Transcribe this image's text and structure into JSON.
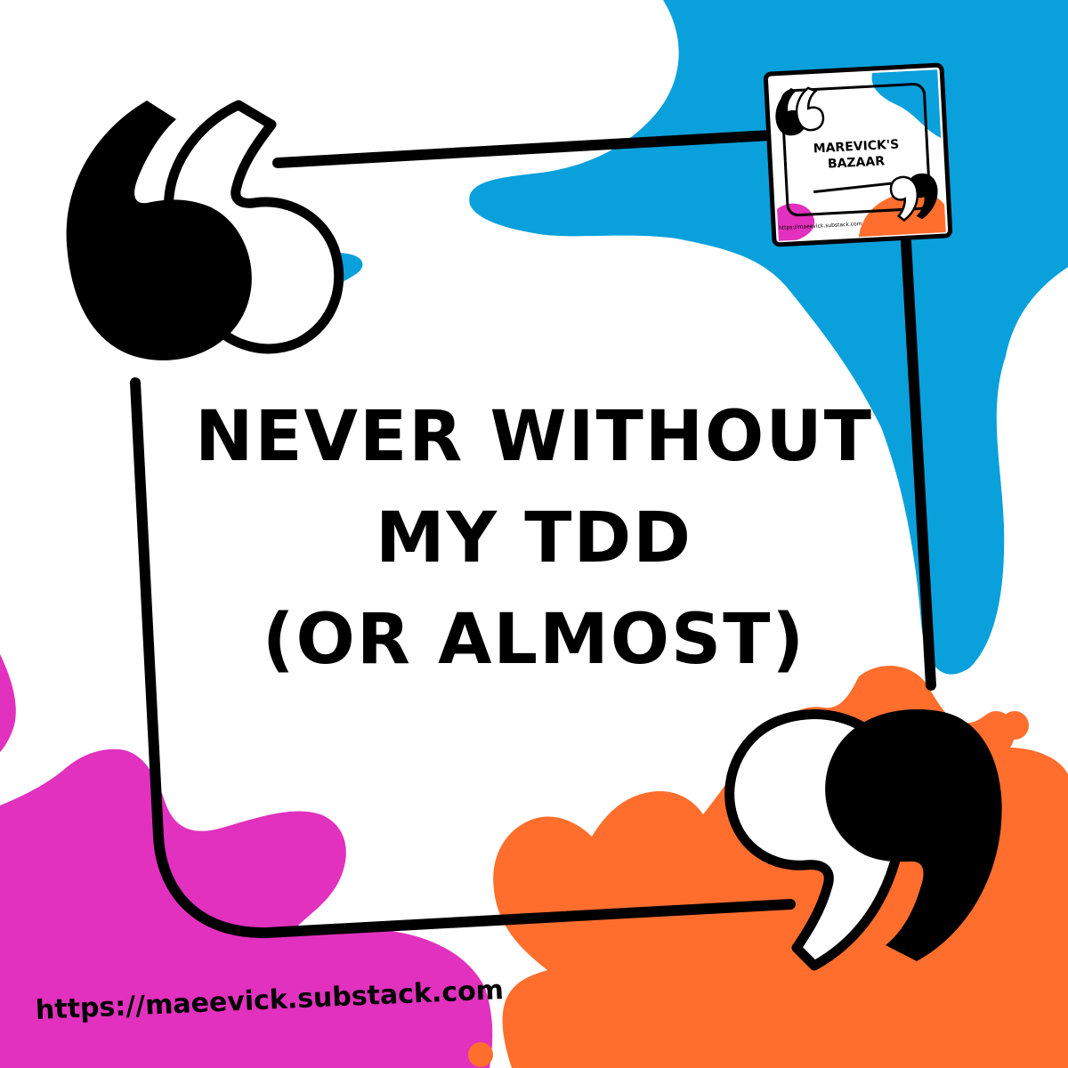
{
  "quote": {
    "lines": [
      "NEVER WITHOUT",
      "MY TDD",
      "(OR ALMOST)"
    ]
  },
  "logo": {
    "line1": "MAREVICK'S",
    "line2": "BAZAAR",
    "url": "https://maeevick.substack.com"
  },
  "footer": {
    "url": "https://maeevick.substack.com"
  },
  "colors": {
    "background": "#ffffff",
    "blue": "#0aa0dc",
    "magenta": "#e131be",
    "orange": "#ff6e2d",
    "ink": "#000000"
  },
  "icons": [
    "open-quote-icon",
    "close-quote-icon",
    "splash-blob"
  ]
}
